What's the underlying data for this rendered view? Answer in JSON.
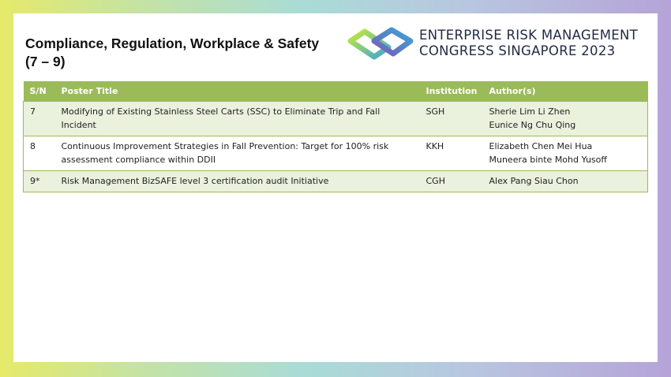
{
  "header": {
    "title_line1": "Compliance, Regulation, Workplace & Safety",
    "title_line2": "(7 – 9)"
  },
  "logo": {
    "line1": "ENTERPRISE RISK MANAGEMENT",
    "line2": "CONGRESS SINGAPORE 2023",
    "icon": "interlocking-loops-logo"
  },
  "table": {
    "columns": [
      "S/N",
      "Poster Title",
      "Institution",
      "Author(s)"
    ],
    "rows": [
      {
        "sn": "7",
        "title": "Modifying of Existing Stainless Steel Carts (SSC) to Eliminate Trip and Fall Incident",
        "institution": "SGH",
        "authors": [
          "Sherie Lim Li Zhen",
          "Eunice Ng Chu Qing"
        ]
      },
      {
        "sn": "8",
        "title": "Continuous Improvement Strategies in Fall Prevention: Target for 100% risk assessment compliance within DDII",
        "institution": "KKH",
        "authors": [
          "Elizabeth Chen Mei Hua",
          "Muneera binte Mohd Yusoff"
        ]
      },
      {
        "sn": "9*",
        "title": "Risk Management BizSAFE level 3 certification audit Initiative",
        "institution": "CGH",
        "authors": [
          "Alex Pang Siau Chon"
        ]
      }
    ]
  },
  "colors": {
    "header_green": "#9bbb59",
    "alt_row": "#eaf1dd",
    "logo_green": "#a6d84a",
    "logo_blue": "#3aa7d6",
    "logo_purple": "#7a5bb5"
  }
}
